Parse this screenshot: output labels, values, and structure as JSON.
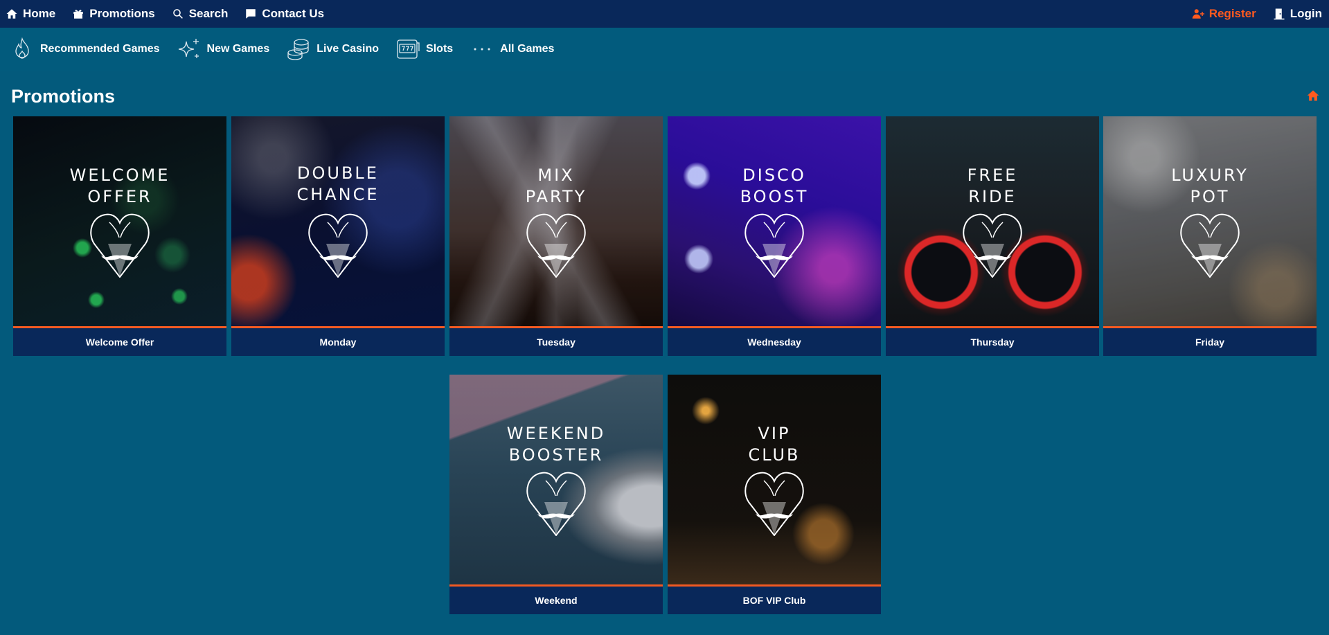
{
  "topbar": {
    "home": "Home",
    "promotions": "Promotions",
    "search": "Search",
    "contact": "Contact Us",
    "register": "Register",
    "login": "Login"
  },
  "categories": [
    {
      "label": "Recommended Games",
      "icon": "flame-icon"
    },
    {
      "label": "New Games",
      "icon": "sparkle-icon"
    },
    {
      "label": "Live Casino",
      "icon": "chips-icon"
    },
    {
      "label": "Slots",
      "icon": "slot-machine-icon"
    },
    {
      "label": "All Games",
      "icon": "dots-icon"
    }
  ],
  "page": {
    "title": "Promotions"
  },
  "promotions": [
    {
      "title_line1": "WELCOME",
      "title_line2": "OFFER",
      "label": "Welcome Offer"
    },
    {
      "title_line1": "DOUBLE",
      "title_line2": "CHANCE",
      "label": "Monday"
    },
    {
      "title_line1": "MIX",
      "title_line2": "PARTY",
      "label": "Tuesday"
    },
    {
      "title_line1": "DISCO",
      "title_line2": "BOOST",
      "label": "Wednesday"
    },
    {
      "title_line1": "FREE",
      "title_line2": "RIDE",
      "label": "Thursday"
    },
    {
      "title_line1": "LUXURY",
      "title_line2": "POT",
      "label": "Friday"
    },
    {
      "title_line1": "WEEKEND",
      "title_line2": "BOOSTER",
      "label": "Weekend"
    },
    {
      "title_line1": "VIP",
      "title_line2": "CLUB",
      "label": "BOF VIP Club"
    }
  ],
  "colors": {
    "topbar": "#09285a",
    "background": "#035a7c",
    "accent": "#ff5a1f",
    "card_label": "#09285a"
  }
}
